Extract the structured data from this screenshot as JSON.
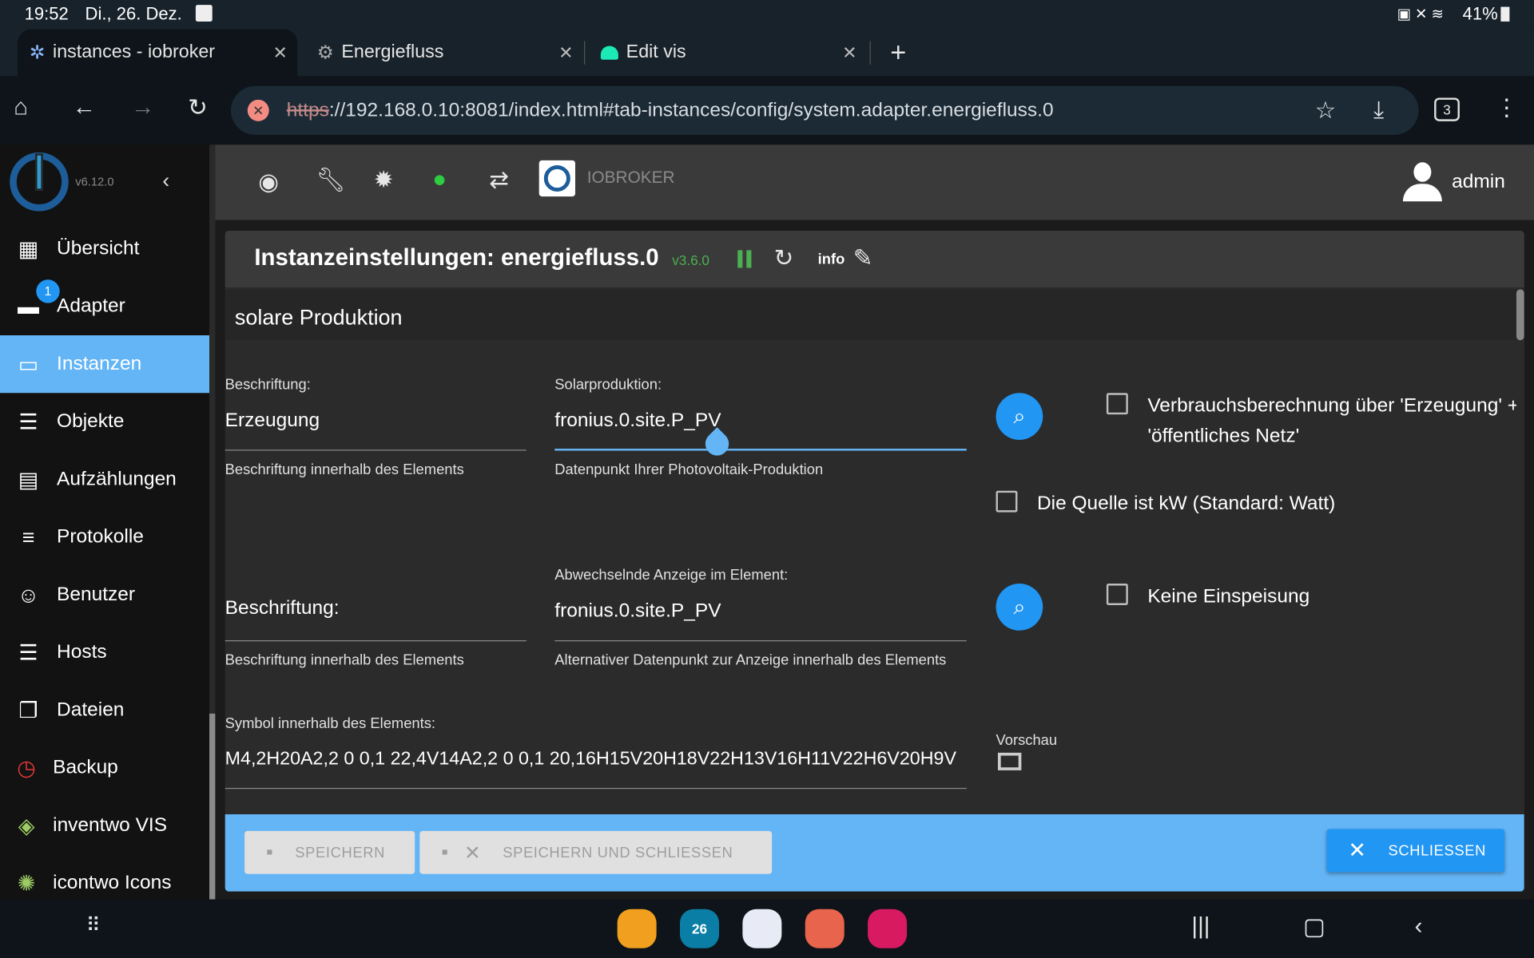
{
  "status": {
    "time": "19:52",
    "date": "Di., 26. Dez.",
    "battery": "41%"
  },
  "browser": {
    "tabs": [
      {
        "label": "instances - iobroker",
        "active": true
      },
      {
        "label": "Energiefluss"
      },
      {
        "label": "Edit vis"
      }
    ],
    "url_scheme": "https",
    "url_rest": "://192.168.0.10:8081/index.html#tab-instances/config/system.adapter.energiefluss.0",
    "tab_count": "3"
  },
  "sidebar": {
    "version": "v6.12.0",
    "items": [
      {
        "label": "Übersicht",
        "icon": "grid-icon"
      },
      {
        "label": "Adapter",
        "icon": "store-icon",
        "badge": "1"
      },
      {
        "label": "Instanzen",
        "icon": "instances-icon",
        "selected": true
      },
      {
        "label": "Objekte",
        "icon": "list-icon"
      },
      {
        "label": "Aufzählungen",
        "icon": "enum-icon"
      },
      {
        "label": "Protokolle",
        "icon": "log-icon"
      },
      {
        "label": "Benutzer",
        "icon": "user-icon"
      },
      {
        "label": "Hosts",
        "icon": "hosts-icon"
      },
      {
        "label": "Dateien",
        "icon": "files-icon"
      },
      {
        "label": "Backup",
        "icon": "backup-icon"
      },
      {
        "label": "inventwo VIS",
        "icon": "inventwo-icon"
      },
      {
        "label": "icontwo Icons",
        "icon": "icontwo-icon"
      }
    ]
  },
  "topbar": {
    "brand": "IOBROKER",
    "user": "admin"
  },
  "dialog": {
    "title": "Instanzeinstellungen: energiefluss.0",
    "version": "v3.6.0",
    "info": "info",
    "section": "solare Produktion",
    "row1": {
      "label_caption": "Beschriftung:",
      "label_value": "Erzeugung",
      "label_help": "Beschriftung innerhalb des Elements",
      "dp_caption": "Solarproduktion:",
      "dp_value": "fronius.0.site.P_PV",
      "dp_help": "Datenpunkt Ihrer Photovoltaik-Produktion",
      "cb1": "Verbrauchsberechnung über 'Erzeugung' +",
      "cb1b": "'öffentliches Netz'",
      "cb2": "Die Quelle ist kW (Standard: Watt)"
    },
    "row2": {
      "label_value": "Beschriftung:",
      "label_help": "Beschriftung innerhalb des Elements",
      "dp_caption": "Abwechselnde Anzeige im Element:",
      "dp_value": "fronius.0.site.P_PV",
      "dp_help": "Alternativer Datenpunkt zur Anzeige innerhalb des Elements",
      "cb1": "Keine Einspeisung"
    },
    "symbol": {
      "caption": "Symbol innerhalb des Elements:",
      "value": "M4,2H20A2,2 0 0,1 22,4V14A2,2 0 0,1 20,16H15V20H18V22H13V16H11V22H6V20H9V",
      "preview": "Vorschau"
    },
    "buttons": {
      "save": "SPEICHERN",
      "save_close": "SPEICHERN UND SCHLIESSEN",
      "close": "SCHLIESSEN"
    }
  },
  "colors": {
    "accent": "#64b5f6",
    "primary": "#2196f3",
    "version_green": "#4caf50"
  }
}
